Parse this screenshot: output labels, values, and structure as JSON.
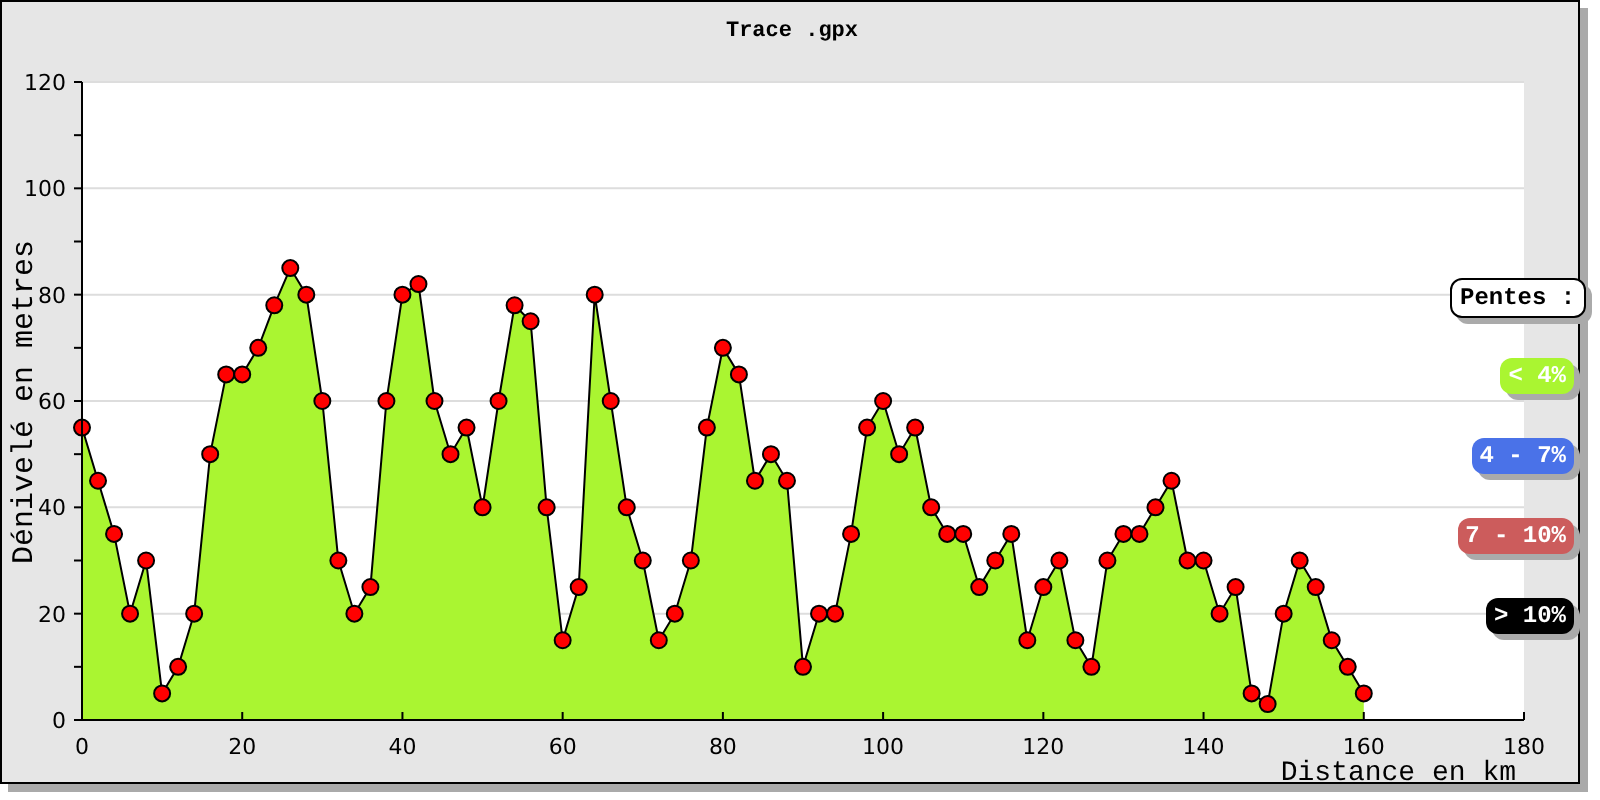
{
  "chart_data": {
    "type": "area",
    "title": "Trace .gpx",
    "xlabel": "Distance en km",
    "ylabel": "Dénivelé en metres",
    "x": [
      0,
      2,
      4,
      6,
      8,
      10,
      12,
      14,
      16,
      18,
      20,
      22,
      24,
      26,
      28,
      30,
      32,
      34,
      36,
      38,
      40,
      42,
      44,
      46,
      48,
      50,
      52,
      54,
      56,
      58,
      60,
      62,
      64,
      66,
      68,
      70,
      72,
      74,
      76,
      78,
      80,
      82,
      84,
      86,
      88,
      90,
      92,
      94,
      96,
      98,
      100,
      102,
      104,
      106,
      108,
      110,
      112,
      114,
      116,
      118,
      120,
      122,
      124,
      126,
      128,
      130,
      132,
      134,
      136,
      138,
      140,
      142,
      144,
      146,
      148,
      150,
      152,
      154,
      156,
      158,
      160
    ],
    "series": [
      {
        "color": "#aaf531",
        "values": [
          55,
          45,
          35,
          20,
          30,
          5,
          10,
          20,
          50,
          65,
          65,
          70,
          78,
          85,
          80,
          60,
          30,
          20,
          25,
          60,
          80,
          82,
          60,
          50,
          55,
          40,
          60,
          78,
          75,
          40,
          15,
          25,
          80,
          60,
          40,
          30,
          15,
          20,
          30,
          55,
          70,
          65,
          45,
          50,
          45,
          10,
          20,
          20,
          35,
          55,
          60,
          50,
          55,
          40,
          35,
          35,
          25,
          30,
          35,
          15,
          25,
          30,
          15,
          10,
          30,
          35,
          35,
          40,
          45,
          30,
          30,
          20,
          25,
          5,
          3,
          20,
          30,
          25,
          15,
          10,
          5
        ]
      }
    ],
    "xlim": [
      0,
      180
    ],
    "ylim": [
      0,
      120
    ],
    "xticks": [
      0,
      20,
      40,
      60,
      80,
      100,
      120,
      140,
      160,
      180
    ],
    "yticks": [
      0,
      20,
      40,
      60,
      80,
      100,
      120
    ],
    "grid": true
  },
  "legend": {
    "title": "Pentes :",
    "items": [
      {
        "label": "< 4%",
        "color": "#aaf531"
      },
      {
        "label": "4 - 7%",
        "color": "#4a72e8"
      },
      {
        "label": "7 - 10%",
        "color": "#cc5c5c"
      },
      {
        "label": "> 10%",
        "color": "#000000"
      }
    ]
  }
}
